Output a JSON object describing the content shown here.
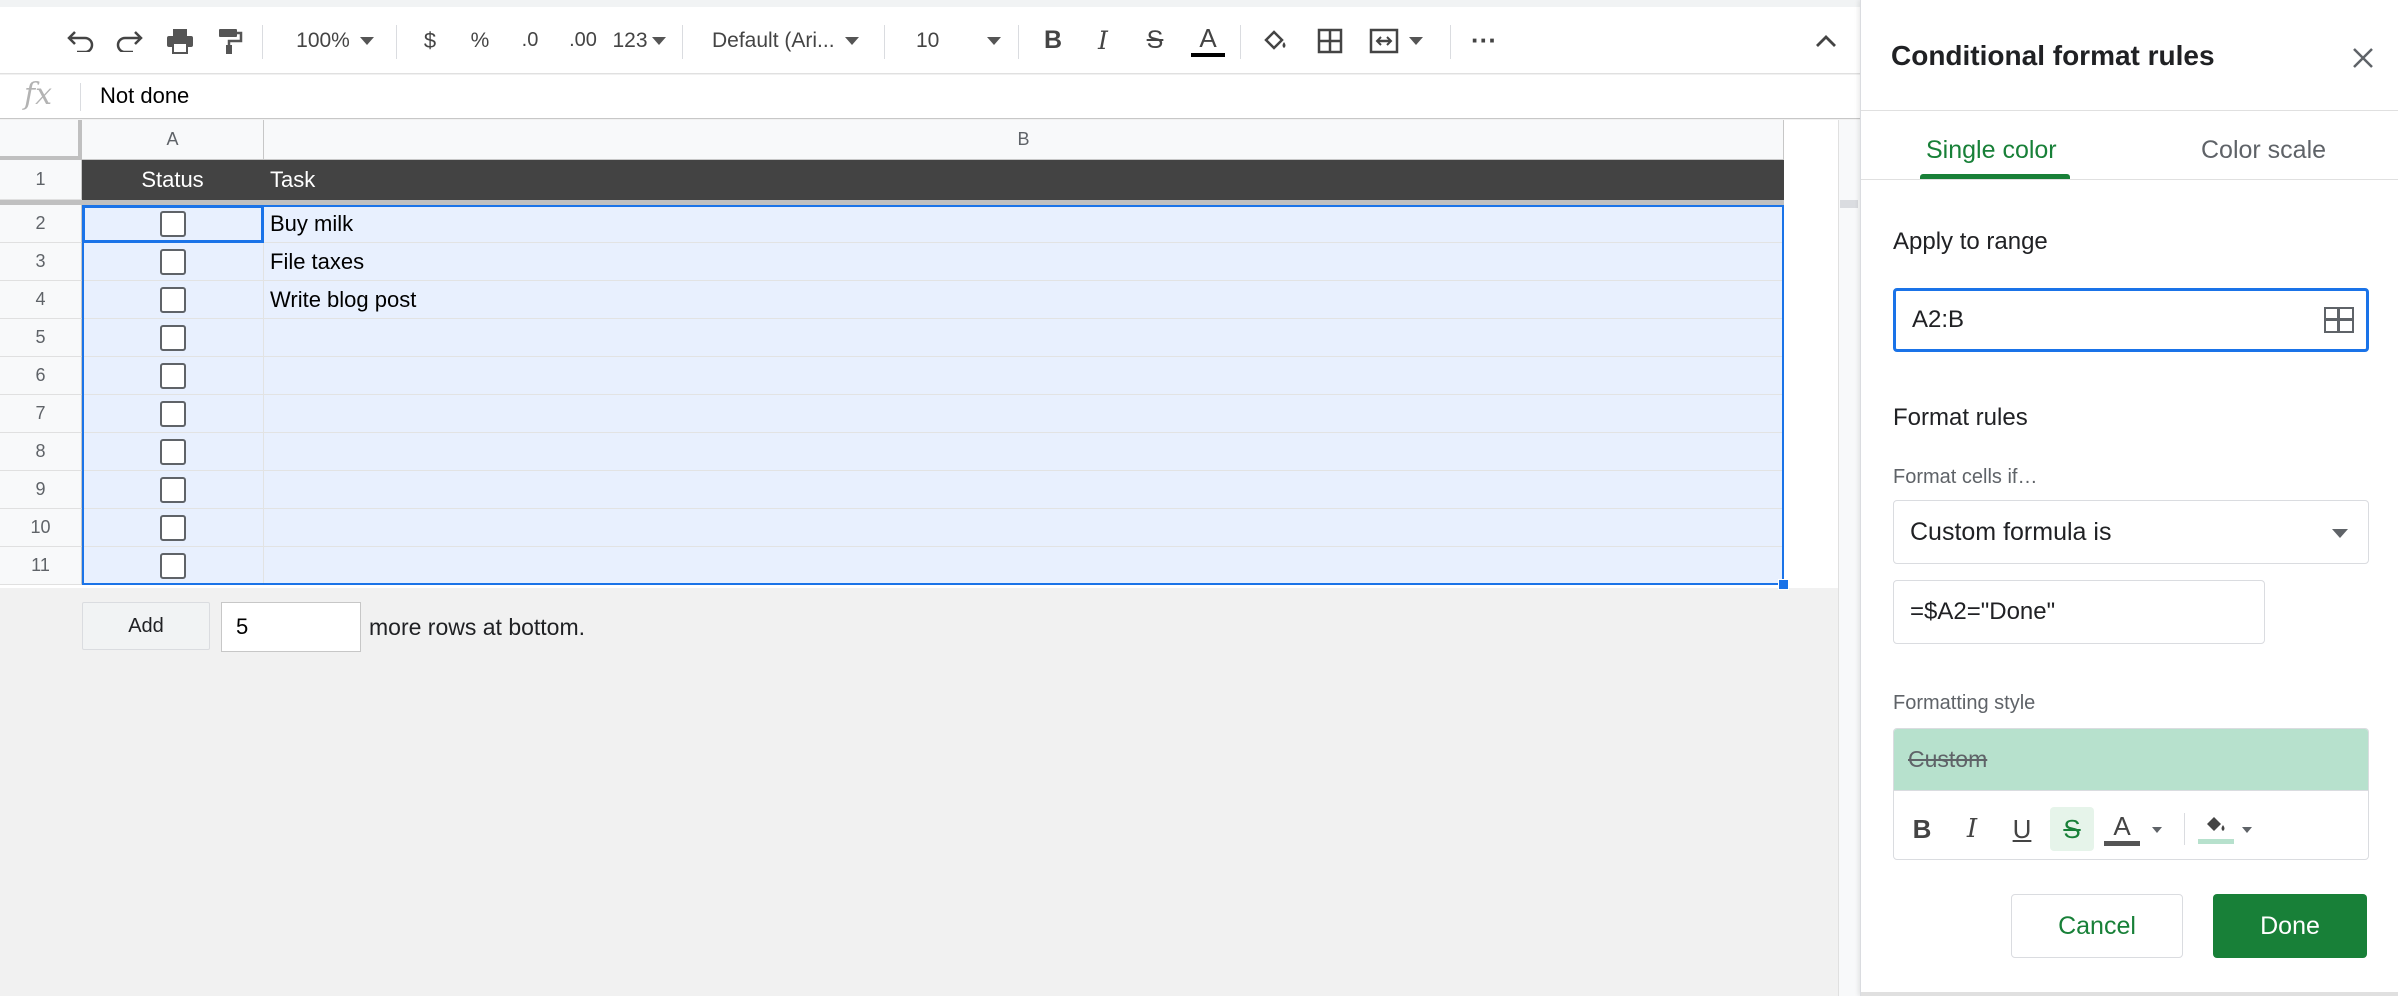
{
  "toolbar": {
    "zoom": "100%",
    "currency": "$",
    "percent": "%",
    "decrease_decimal": ".0",
    "increase_decimal": ".00",
    "number_format": "123",
    "font": "Default (Ari...",
    "font_size": "10",
    "bold": "B",
    "italic": "I",
    "strikethrough": "S",
    "text_color": "A",
    "more": "···"
  },
  "formula_bar": {
    "fx": "fx",
    "value": "Not done"
  },
  "sheet": {
    "columns": [
      "A",
      "B"
    ],
    "rows": [
      "1",
      "2",
      "3",
      "4",
      "5",
      "6",
      "7",
      "8",
      "9",
      "10",
      "11"
    ],
    "header": {
      "status": "Status",
      "task": "Task"
    },
    "tasks": [
      "Buy milk",
      "File taxes",
      "Write blog post",
      "",
      "",
      "",
      "",
      "",
      "",
      ""
    ],
    "add_rows": {
      "button": "Add",
      "count": "5",
      "suffix": "more rows at bottom."
    }
  },
  "panel": {
    "title": "Conditional format rules",
    "tabs": {
      "single": "Single color",
      "scale": "Color scale"
    },
    "apply_label": "Apply to range",
    "range": "A2:B",
    "format_rules_label": "Format rules",
    "format_cells_if_label": "Format cells if…",
    "condition": "Custom formula is",
    "formula": "=$A2=\"Done\"",
    "formatting_style_label": "Formatting style",
    "style_preview": "Custom",
    "style_buttons": {
      "bold": "B",
      "italic": "I",
      "underline": "U",
      "strike": "S",
      "text_color": "A"
    },
    "cancel": "Cancel",
    "done": "Done"
  },
  "colors": {
    "header_bg": "#434343",
    "selection_bg": "#e8f0fe",
    "selection_border": "#1a73e8",
    "style_fill": "#b7e1cd",
    "accent_green": "#188038"
  }
}
